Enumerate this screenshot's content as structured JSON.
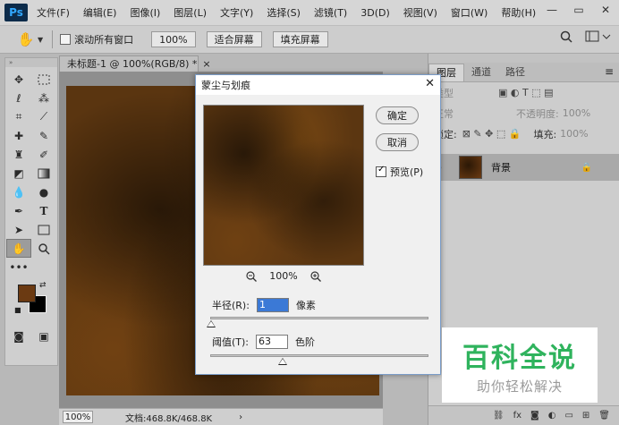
{
  "app": {
    "logo": "Ps"
  },
  "menu": [
    "文件(F)",
    "编辑(E)",
    "图像(I)",
    "图层(L)",
    "文字(Y)",
    "选择(S)",
    "滤镜(T)",
    "3D(D)",
    "视图(V)",
    "窗口(W)",
    "帮助(H)"
  ],
  "window_controls": {
    "minimize": "—",
    "restore": "▭",
    "close": "✕"
  },
  "options_bar": {
    "scroll_all_label": "滚动所有窗口",
    "zoom_button": "100%",
    "fit_screen": "适合屏幕",
    "fill_screen": "填充屏幕"
  },
  "document": {
    "tab_title": "未标题-1 @ 100%(RGB/8) *",
    "tab_close": "×",
    "status_zoom": "100%",
    "status_info": "文档:468.8K/468.8K",
    "status_arrow": "›"
  },
  "colors": {
    "foreground": "#6b3a12",
    "background": "#000000",
    "accent": "#3b79d6"
  },
  "layers_panel": {
    "tabs": [
      "图层",
      "通道",
      "路径"
    ],
    "kind_label": "类型",
    "blend_mode": "正常",
    "opacity_label": "不透明度:",
    "opacity_value": "100%",
    "lock_label": "锁定:",
    "fill_label": "填充:",
    "fill_value": "100%",
    "layer_name": "背景"
  },
  "dialog": {
    "title": "蒙尘与划痕",
    "ok": "确定",
    "cancel": "取消",
    "preview_label": "预览(P)",
    "preview_checked": true,
    "zoom_value": "100%",
    "radius_label": "半径(R):",
    "radius_value": "1",
    "radius_unit": "像素",
    "threshold_label": "阈值(T):",
    "threshold_value": "63",
    "threshold_unit": "色阶",
    "radius_slider_fraction": 0.0,
    "threshold_slider_fraction": 0.33
  },
  "watermark": {
    "main": "百科全说",
    "sub": "助你轻松解决"
  }
}
